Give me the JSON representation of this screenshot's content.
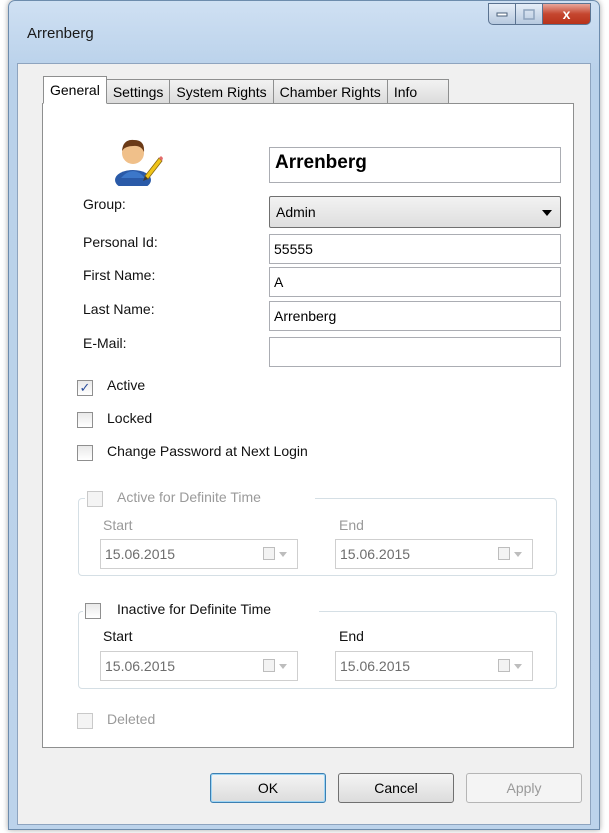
{
  "window": {
    "title": "Arrenberg",
    "close_glyph": "x"
  },
  "tabs": [
    {
      "label": "General",
      "active": true
    },
    {
      "label": "Settings",
      "active": false
    },
    {
      "label": "System Rights",
      "active": false
    },
    {
      "label": "Chamber Rights",
      "active": false
    },
    {
      "label": "Info",
      "active": false
    }
  ],
  "general": {
    "display_name": "Arrenberg",
    "group_label": "Group:",
    "group_value": "Admin",
    "personal_id_label": "Personal Id:",
    "personal_id_value": "55555",
    "first_name_label": "First Name:",
    "first_name_value": "A",
    "last_name_label": "Last Name:",
    "last_name_value": "Arrenberg",
    "email_label": "E-Mail:",
    "email_value": "",
    "active_label": "Active",
    "active_checked": true,
    "checkmark": "✓",
    "locked_label": "Locked",
    "locked_checked": false,
    "change_password_label": "Change Password at Next Login",
    "change_password_checked": false,
    "active_definite": {
      "label": "Active for Definite Time",
      "start_label": "Start",
      "end_label": "End",
      "start_value": "15.06.2015",
      "end_value": "15.06.2015"
    },
    "inactive_definite": {
      "label": "Inactive for Definite Time",
      "start_label": "Start",
      "end_label": "End",
      "start_value": "15.06.2015",
      "end_value": "15.06.2015"
    },
    "deleted_label": "Deleted"
  },
  "buttons": {
    "ok": "OK",
    "cancel": "Cancel",
    "apply": "Apply"
  }
}
